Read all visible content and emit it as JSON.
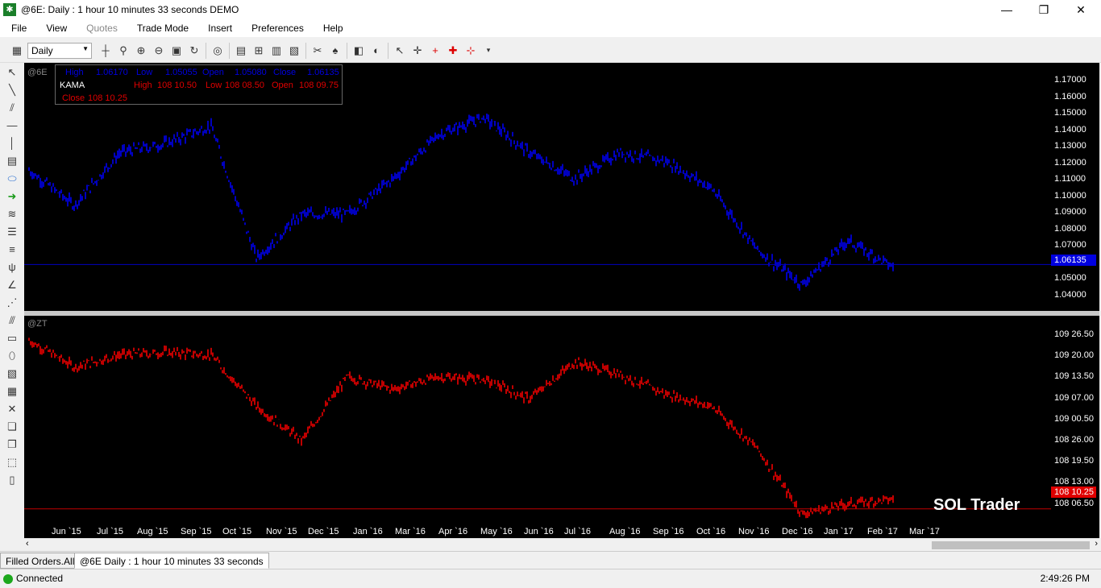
{
  "window": {
    "title": "@6E: Daily : 1 hour 10 minutes 33 seconds DEMO",
    "minimize_glyph": "—",
    "maximize_glyph": "❐",
    "close_glyph": "✕"
  },
  "menu": {
    "file": "File",
    "view": "View",
    "quotes": "Quotes",
    "trade_mode": "Trade Mode",
    "insert": "Insert",
    "preferences": "Preferences",
    "help": "Help"
  },
  "toolbar": {
    "interval": "Daily"
  },
  "infobox": {
    "sym1_high_label": "High",
    "sym1_high": "1.06170",
    "sym1_low_label": "Low",
    "sym1_low": "1.05055",
    "sym1_open_label": "Open",
    "sym1_open": "1.05080",
    "sym1_close_label": "Close",
    "sym1_close": "1.06135",
    "indicator": "KAMA",
    "sym2_high_label": "High",
    "sym2_high": "108 10.50",
    "sym2_low_label": "Low",
    "sym2_low": "108 08.50",
    "sym2_open_label": "Open",
    "sym2_open": "108 09.75",
    "sym2_close_label": "Close",
    "sym2_close": "108 10.25"
  },
  "pane1": {
    "symbol": "@6E",
    "last_price": "1.06135",
    "color": "#0000ff",
    "y_labels": [
      "1.17000",
      "1.16000",
      "1.15000",
      "1.14000",
      "1.13000",
      "1.12000",
      "1.11000",
      "1.10000",
      "1.09000",
      "1.08000",
      "1.07000",
      "1.06000",
      "1.05000",
      "1.04000"
    ]
  },
  "pane2": {
    "symbol": "@ZT",
    "last_price": "108 10.25",
    "color": "#ff0000",
    "y_labels": [
      "109 26.50",
      "109 20.00",
      "109 13.50",
      "109 07.00",
      "109 00.50",
      "108 26.00",
      "108 19.50",
      "108 13.00",
      "108 06.50"
    ]
  },
  "x_labels": [
    "Jun `15",
    "Jul `15",
    "Aug `15",
    "Sep `15",
    "Oct `15",
    "Nov `15",
    "Dec `15",
    "Jan `16",
    "Mar `16",
    "Apr `16",
    "May `16",
    "Jun `16",
    "Jul `16",
    "Aug `16",
    "Sep `16",
    "Oct `16",
    "Nov `16",
    "Dec `16",
    "Jan `17",
    "Feb `17",
    "Mar `17"
  ],
  "watermark": "SOL Trader",
  "tabs": {
    "orders": "Filled Orders.All:0",
    "chart": "@6E Daily : 1 hour 10 minutes 33 seconds"
  },
  "status": {
    "connection": "Connected",
    "time": "2:49:26 PM"
  },
  "chart_data": [
    {
      "type": "bar",
      "symbol": "@6E",
      "series": [
        {
          "name": "@6E",
          "x": [
            "Jun `15",
            "Jul `15",
            "Aug `15",
            "Sep `15",
            "Oct `15",
            "Nov `15",
            "Dec `15",
            "Jan `16",
            "Mar `16",
            "Apr `16",
            "May `16",
            "Jun `16",
            "Jul `16",
            "Aug `16",
            "Sep `16",
            "Oct `16",
            "Nov `16",
            "Dec `16",
            "Jan `17",
            "Feb `17"
          ],
          "values": [
            1.115,
            1.095,
            1.125,
            1.13,
            1.14,
            1.065,
            1.09,
            1.09,
            1.11,
            1.135,
            1.145,
            1.125,
            1.11,
            1.125,
            1.12,
            1.105,
            1.07,
            1.05,
            1.075,
            1.06
          ]
        }
      ],
      "ylim": [
        1.035,
        1.175
      ]
    },
    {
      "type": "bar",
      "symbol": "@ZT",
      "series": [
        {
          "name": "@ZT",
          "x": [
            "Jun `15",
            "Jul `15",
            "Aug `15",
            "Sep `15",
            "Oct `15",
            "Nov `15",
            "Dec `15",
            "Jan `16",
            "Mar `16",
            "Apr `16",
            "May `16",
            "Jun `16",
            "Jul `16",
            "Aug `16",
            "Sep `16",
            "Oct `16",
            "Nov `16",
            "Dec `16",
            "Jan `17",
            "Feb `17"
          ],
          "values": [
            109.7,
            109.48,
            109.58,
            109.6,
            109.58,
            109.16,
            108.88,
            109.4,
            109.3,
            109.4,
            109.38,
            109.22,
            109.52,
            109.42,
            109.26,
            109.16,
            108.82,
            108.28,
            108.36,
            108.4
          ]
        }
      ],
      "ylim": [
        108.2,
        109.9
      ]
    }
  ]
}
